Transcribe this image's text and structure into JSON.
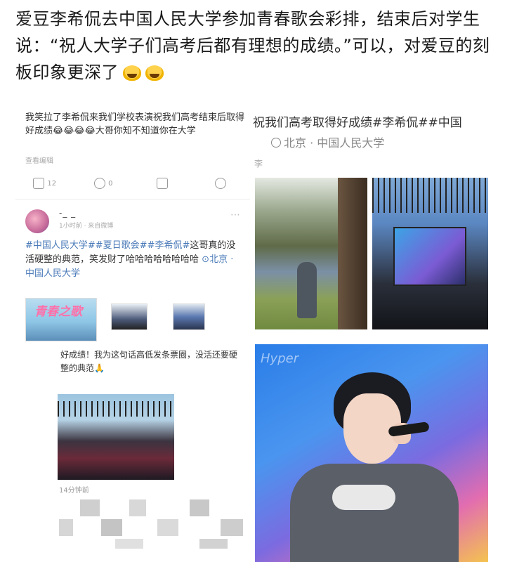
{
  "headline": {
    "text": "爱豆李希侃去中国人民大学参加青春歌会彩排，结束后对学生说：“祝人大学子们高考后都有理想的成绩。”可以，对爱豆的刻板印象更深了",
    "emojis": [
      "laughing-emoji",
      "laughing-emoji"
    ]
  },
  "post1": {
    "text": "我笑拉了李希侃来我们学校表演祝我们高考结束后取得好成绩😂😂😂😂大哥你知不知道你在大学",
    "edited": "查看编辑",
    "actions": {
      "share_count": "12",
      "comment_count": "0"
    }
  },
  "post2": {
    "username": "-_ _",
    "meta": "1小时前 · 来自微博",
    "hashtags": "#中国人民大学##夏日歌会##李希侃#",
    "text": "这哥真的没活硬整的典范，笑发财了哈哈哈哈哈哈哈哈",
    "location": "北京 · 中国人民大学",
    "thumb_title": "青春之歌"
  },
  "post3": {
    "text": "好成绩！我为这句话高低发条票圈，没活还要硬整的典范🙏",
    "time": "14分钟前"
  },
  "post4": {
    "text": "祝我们高考取得好成绩#李希侃##中国",
    "location": "北京 · 中国人民大学",
    "side_text": "李"
  },
  "photos": {
    "watermark": "Hyper"
  },
  "colors": {
    "hashtag_blue": "#4a7ab8",
    "text_dark": "#1a1a1a",
    "meta_gray": "#999999"
  }
}
